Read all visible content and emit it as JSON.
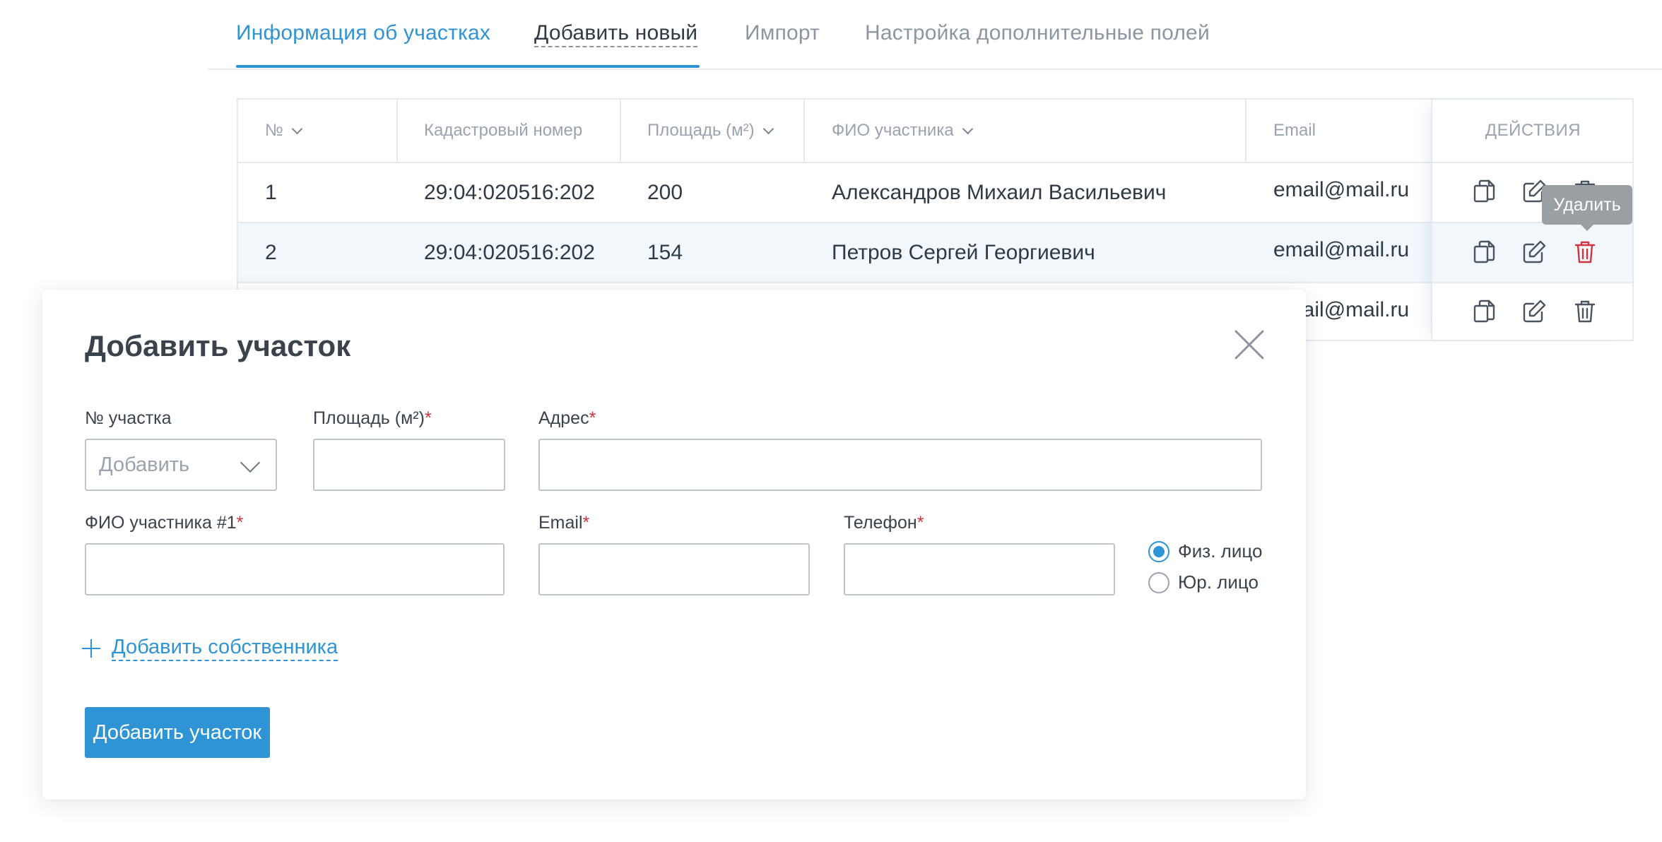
{
  "tabs": [
    {
      "label": "Информация об участках",
      "active": true
    },
    {
      "label": "Добавить новый",
      "active": false
    },
    {
      "label": "Импорт",
      "active": false
    },
    {
      "label": "Настройка дополнительные полей",
      "active": false
    }
  ],
  "table": {
    "headers": {
      "num": "№",
      "cadastral": "Кадастровый номер",
      "area": "Площадь (м²)",
      "owner": "ФИО участника",
      "email": "Email",
      "actions": "ДЕЙСТВИЯ"
    },
    "rows": [
      {
        "num": "1",
        "cadastral": "29:04:020516:202",
        "area": "200",
        "owner": "Александров Михаил Васильевич",
        "email": "email@mail.ru"
      },
      {
        "num": "2",
        "cadastral": "29:04:020516:202",
        "area": "154",
        "owner": "Петров Сергей Георгиевич",
        "email": "email@mail.ru"
      },
      {
        "num": "",
        "cadastral": "",
        "area": "",
        "owner": "",
        "email": "email@mail.ru"
      }
    ],
    "tooltip": "Удалить",
    "icons": {
      "copy": "copy-icon",
      "edit": "edit-icon",
      "delete": "trash-icon"
    },
    "colors": {
      "accent": "#2f94d6",
      "danger": "#d0343e"
    }
  },
  "modal": {
    "title": "Добавить участок",
    "fields": {
      "plot_number": {
        "label": "№ участка",
        "placeholder": "Добавить",
        "required": false
      },
      "area": {
        "label": "Площадь (м²)",
        "required": true,
        "value": ""
      },
      "address": {
        "label": "Адрес",
        "required": true,
        "value": ""
      },
      "owner_name": {
        "label": "ФИО участника #1",
        "required": true,
        "value": ""
      },
      "email": {
        "label": "Email",
        "required": true,
        "value": ""
      },
      "phone": {
        "label": "Телефон",
        "required": true,
        "value": ""
      }
    },
    "required_mark": "*",
    "person_type": {
      "options": [
        "Физ. лицо",
        "Юр. лицо"
      ],
      "selected": "Физ. лицо"
    },
    "add_owner_label": "Добавить собственника",
    "submit_label": "Добавить участок"
  }
}
